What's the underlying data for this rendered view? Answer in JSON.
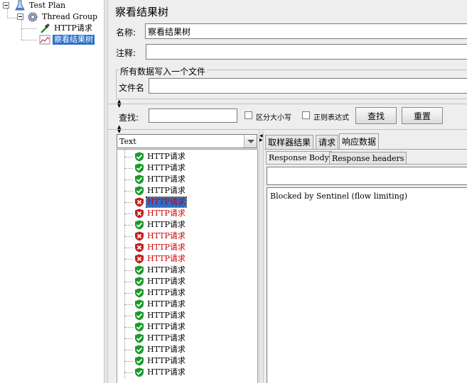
{
  "tree": {
    "test_plan": "Test Plan",
    "thread_group": "Thread Group",
    "http_request": "HTTP请求",
    "view_results_tree": "察看结果树"
  },
  "panel": {
    "title": "察看结果树",
    "name_label": "名称:",
    "name_value": "察看结果树",
    "comment_label": "注释:",
    "comment_value": "",
    "file_group_title": "所有数据写入一个文件",
    "file_name_label": "文件名",
    "file_name_value": ""
  },
  "search": {
    "label": "查找:",
    "value": "",
    "case_sensitive_label": "区分大小写",
    "case_sensitive_checked": false,
    "regex_label": "正则表达式",
    "regex_checked": false,
    "search_button": "查找",
    "reset_button": "重置"
  },
  "renderer": {
    "selected": "Text"
  },
  "results": [
    {
      "label": "HTTP请求",
      "status": "success"
    },
    {
      "label": "HTTP请求",
      "status": "success"
    },
    {
      "label": "HTTP请求",
      "status": "success"
    },
    {
      "label": "HTTP请求",
      "status": "success"
    },
    {
      "label": "HTTP请求",
      "status": "fail",
      "selected": true
    },
    {
      "label": "HTTP请求",
      "status": "fail"
    },
    {
      "label": "HTTP请求",
      "status": "success"
    },
    {
      "label": "HTTP请求",
      "status": "fail"
    },
    {
      "label": "HTTP请求",
      "status": "fail"
    },
    {
      "label": "HTTP请求",
      "status": "fail"
    },
    {
      "label": "HTTP请求",
      "status": "success"
    },
    {
      "label": "HTTP请求",
      "status": "success"
    },
    {
      "label": "HTTP请求",
      "status": "success"
    },
    {
      "label": "HTTP请求",
      "status": "success"
    },
    {
      "label": "HTTP请求",
      "status": "success"
    },
    {
      "label": "HTTP请求",
      "status": "success"
    },
    {
      "label": "HTTP请求",
      "status": "success"
    },
    {
      "label": "HTTP请求",
      "status": "success"
    },
    {
      "label": "HTTP请求",
      "status": "success"
    },
    {
      "label": "HTTP请求",
      "status": "success"
    }
  ],
  "tabs": [
    "取样器结果",
    "请求",
    "响应数据"
  ],
  "active_tab": "响应数据",
  "subtabs": [
    "Response Body",
    "Response headers"
  ],
  "active_subtab": "Response Body",
  "response_body_text": "Blocked by Sentinel (flow limiting)",
  "colors": {
    "selection": "#2a6fc9",
    "fail_text": "#d00000",
    "success_icon": "#1a9a2a",
    "fail_icon": "#c02020"
  }
}
